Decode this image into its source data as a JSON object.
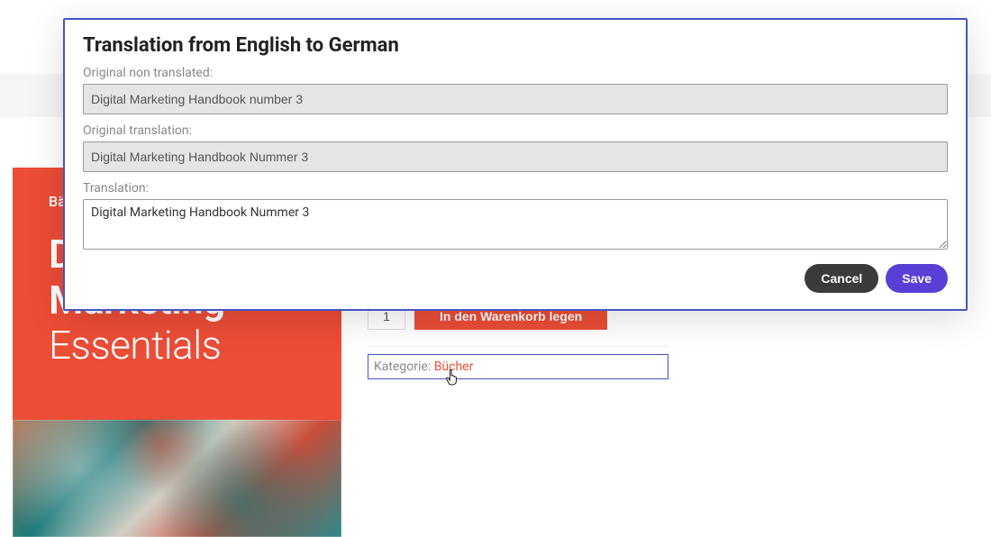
{
  "modal": {
    "title": "Translation from English to German",
    "original_label": "Original non translated:",
    "original_value": "Digital Marketing Handbook number 3",
    "orig_trans_label": "Original translation:",
    "orig_trans_value": "Digital Marketing Handbook Nummer 3",
    "translation_label": "Translation:",
    "translation_value": "Digital Marketing Handbook Nummer 3",
    "cancel_label": "Cancel",
    "save_label": "Save"
  },
  "product": {
    "cover_meta": "Bä",
    "cover_line1_prefix": "D",
    "cover_line2": "Marketing",
    "cover_line3": "Essentials",
    "qty_value": "1",
    "add_to_cart": "In den Warenkorb legen",
    "category_label": "Kategorie: ",
    "category_link": "Bücher"
  }
}
